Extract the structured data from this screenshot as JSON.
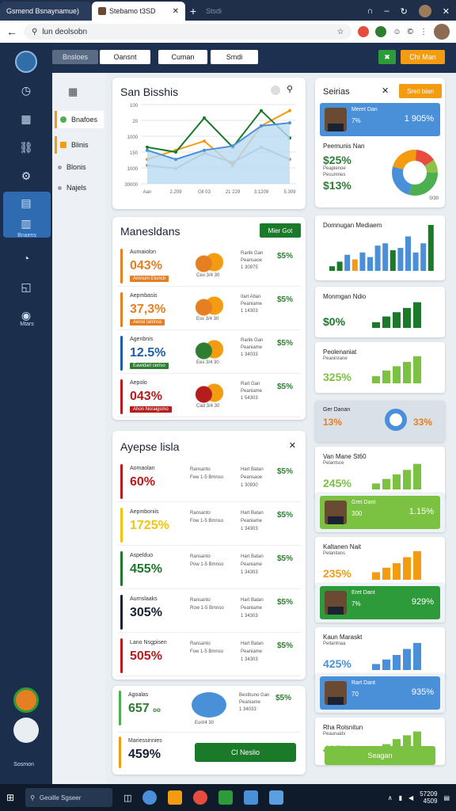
{
  "browser": {
    "tab1": "Gsmend Bsnaynamue)",
    "tab2": "Stebamo t3SD",
    "tab_ghost": "Stsdi",
    "address": "lun deolsobn"
  },
  "topbar": {
    "buttons": [
      "Bnsloes",
      "Oansnt",
      "Cuman",
      "Smdi"
    ],
    "add_icon": "✖",
    "cta": "Chi Man"
  },
  "sidebar": {
    "active_label": "Bnaens",
    "bottom_label": "Mtars",
    "footer_label": "Sosmon"
  },
  "left_nav": [
    {
      "label": "Bnafoes",
      "color": "#4caf50"
    },
    {
      "label": "Blinis",
      "color": "#f39c12"
    },
    {
      "label": "Blonis",
      "color": "#9e9e9e"
    },
    {
      "label": "Najels",
      "color": "#9e9e9e"
    }
  ],
  "main_chart": {
    "title": "San Bisshis",
    "chart_data": {
      "type": "line",
      "categories": [
        "Aan",
        "2.209",
        "Gll 03",
        "21 229",
        "3.1209",
        "5.309"
      ],
      "yticks": [
        "30000",
        "1000",
        "150",
        "1000",
        "20",
        "100"
      ],
      "series": [
        {
          "values": [
            40,
            55,
            70,
            30,
            95,
            120
          ],
          "color": "#f39c12"
        },
        {
          "values": [
            60,
            52,
            108,
            60,
            120,
            75
          ],
          "color": "#1b7a2a"
        },
        {
          "values": [
            30,
            25,
            50,
            35,
            60,
            40
          ],
          "color": "#9e9e9e"
        },
        {
          "values": [
            55,
            40,
            55,
            62,
            95,
            100
          ],
          "color": "#4a90d9",
          "fill": "#b9d9f2"
        }
      ]
    }
  },
  "manes": {
    "title": "Manesldans",
    "button": "Mier Got",
    "rows": [
      {
        "label": "Aumaiolon",
        "value": "043%",
        "color": "#e67e22",
        "sub": "Arnnum Eluncb",
        "subcolor": "#e67e22",
        "cap": "Ceu 3/4 30",
        "mid": "Rarlik Gan\nPeansaoe\n1 30975",
        "pct": "$5%"
      },
      {
        "label": "Aepmbasis",
        "value": "37,3%",
        "color": "#e67e22",
        "sub": "Aenoi tanlnce",
        "subcolor": "#e67e22",
        "cap": "Esv 3/4 30",
        "mid": "Itart Atlan\nPeaniame\n1 14303",
        "pct": "$5%"
      },
      {
        "label": "Agenbnis",
        "value": "12.5%",
        "color": "#1a5fa8",
        "sub": "Eawidarl ceriso",
        "subcolor": "#2e7d32",
        "cap": "Ees 3/4 30",
        "mid": "Rarlik Gan\nPeaniame\n1 34033",
        "pct": "$5%"
      },
      {
        "label": "Aepolo",
        "value": "043%",
        "color": "#b71c1c",
        "sub": "Ahon Noraigsmo",
        "subcolor": "#b71c1c",
        "cap": "Cad 3/4 30",
        "mid": "Rart Gan\nPeaniame\n1 54303",
        "pct": "$5%"
      }
    ]
  },
  "ayepse": {
    "title": "Ayepse lisla",
    "rows": [
      {
        "label": "Aomaolan",
        "value": "60%",
        "color": "#b71c1c",
        "tags": "Ransanto\nFew 1-5 Bmnso",
        "mid": "Hart Batan\nPeansaoe\n1 30930",
        "pct": "$5%"
      },
      {
        "label": "Aepmboniis",
        "value": "1725%",
        "color": "#f1c40f",
        "tags": "Ransanto\nFow 1-5 Bmnso",
        "mid": "Hart Batan\nPeaniame\n1 34303",
        "pct": "$5%"
      },
      {
        "label": "Aspelduo",
        "value": "455%",
        "color": "#1b7a2a",
        "tags": "Ransanto\nPow 1-5 Bmnso",
        "mid": "Hart Batan\nPeaniame\n1 34303",
        "pct": "$5%"
      },
      {
        "label": "Aurnslaaks",
        "value": "305%",
        "color": "#1a2033",
        "tags": "Ransanto\nRow 1-5 Bmnso",
        "mid": "Hart Batan\nPeaniame\n1 34303",
        "pct": "$5%"
      },
      {
        "label": "Lano Nsgpisen",
        "value": "505%",
        "color": "#b71c1c",
        "tags": "Ransanto\nFow 1-5 Bmnso",
        "mid": "Hart Batan\nPeaniame\n1 34303",
        "pct": "$5%"
      }
    ]
  },
  "bottom_card": {
    "label": "Agoalas",
    "value": "657",
    "unit": "oo",
    "sub": "Eorl/4 30",
    "mid": "Bestbuno Gan\nPeaniame\n1 34033",
    "pct": "$5%",
    "label2": "Mariessinnies",
    "value2": "459%",
    "button": "Cl Neslio"
  },
  "right": {
    "header": "Seirias",
    "header_btn": "Sreit bian",
    "person1": {
      "name": "Meret Dan",
      "chip": "7%",
      "val": "1 905%"
    },
    "donut": {
      "title": "Peemunis Nan",
      "v1": "$25%",
      "v1lbl": "Peaplenoe",
      "v2": "$13%",
      "v2lbl": "Pesumnes",
      "caption": "0/30"
    },
    "bar1": {
      "title": "Domnugan Mediaem"
    },
    "bar2": {
      "title": "Monmgan Ndio",
      "value": "$0%"
    },
    "bar3": {
      "title": "Peolenaniat",
      "label": "Peaninrane",
      "value": "325%"
    },
    "ring": {
      "title": "Ger Danan",
      "v1": "13%",
      "v2": "33%"
    },
    "bar4": {
      "title": "Van Mane St60",
      "label": "Pelantsce",
      "value": "245%"
    },
    "person2": {
      "name": "Gret Dant",
      "chip": "300",
      "val": "1.15%"
    },
    "bar5": {
      "title": "Kaltanen Nait",
      "label": "Pelanitans",
      "value": "235%"
    },
    "person3": {
      "name": "Eret Dant",
      "chip": "7%",
      "val": "929%"
    },
    "bar6": {
      "title": "Kaun Maraskt",
      "label": "Pellantnaa",
      "value": "425%"
    },
    "person4": {
      "name": "Rart Dant",
      "chip": "70",
      "val": "935%"
    },
    "bar7": {
      "title": "Rha Rolsnitun",
      "label": "Peaunaidx",
      "value": "435%"
    },
    "button": "Seagan"
  },
  "taskbar": {
    "search": "Geoille Sgseer",
    "time": "57209",
    "date": "4509"
  }
}
